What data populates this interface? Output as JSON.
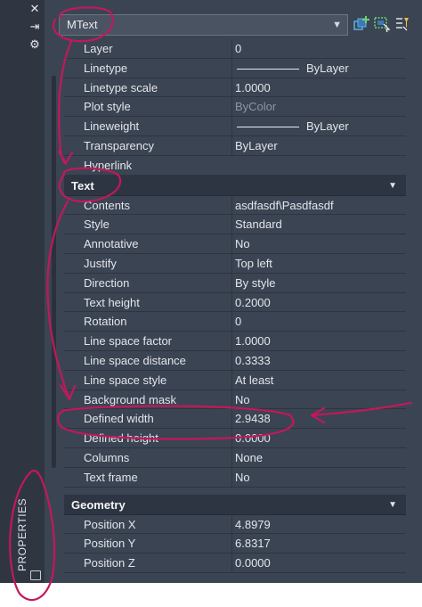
{
  "rail": {
    "close_glyph": "✕",
    "pin_glyph": "⇥",
    "settings_glyph": "⚙",
    "title": "PROPERTIES"
  },
  "header": {
    "selection": "MText",
    "dropdown_icon": "chevron-down-icon",
    "buttons": [
      "toggle-pickadd-icon",
      "select-objects-icon",
      "quick-select-icon"
    ]
  },
  "general_rows": [
    {
      "label": "Layer",
      "value": "0"
    },
    {
      "label": "Linetype",
      "value": "ByLayer",
      "line_glyph": true
    },
    {
      "label": "Linetype scale",
      "value": "1.0000"
    },
    {
      "label": "Plot style",
      "value": "ByColor",
      "muted": true
    },
    {
      "label": "Lineweight",
      "value": "ByLayer",
      "line_glyph": true
    },
    {
      "label": "Transparency",
      "value": "ByLayer"
    },
    {
      "label": "Hyperlink",
      "value": ""
    }
  ],
  "text_section": {
    "title": "Text",
    "rows": [
      {
        "label": "Contents",
        "value": "asdfasdf\\Pasdfasdf"
      },
      {
        "label": "Style",
        "value": "Standard"
      },
      {
        "label": "Annotative",
        "value": "No"
      },
      {
        "label": "Justify",
        "value": "Top left"
      },
      {
        "label": "Direction",
        "value": "By style"
      },
      {
        "label": "Text height",
        "value": "0.2000"
      },
      {
        "label": "Rotation",
        "value": "0"
      },
      {
        "label": "Line space factor",
        "value": "1.0000"
      },
      {
        "label": "Line space distance",
        "value": "0.3333"
      },
      {
        "label": "Line space style",
        "value": "At least"
      },
      {
        "label": "Background mask",
        "value": "No"
      },
      {
        "label": "Defined width",
        "value": "2.9438"
      },
      {
        "label": "Defined height",
        "value": "0.0000"
      },
      {
        "label": "Columns",
        "value": "None"
      },
      {
        "label": "Text frame",
        "value": "No"
      }
    ]
  },
  "geometry_section": {
    "title": "Geometry",
    "rows": [
      {
        "label": "Position X",
        "value": "4.8979"
      },
      {
        "label": "Position Y",
        "value": "6.8317"
      },
      {
        "label": "Position Z",
        "value": "0.0000"
      }
    ]
  },
  "colors": {
    "panel_bg": "#3b4453",
    "rail_bg": "#2f3642",
    "section_bg": "#2e3542",
    "annotation_ink": "#c2185b"
  }
}
